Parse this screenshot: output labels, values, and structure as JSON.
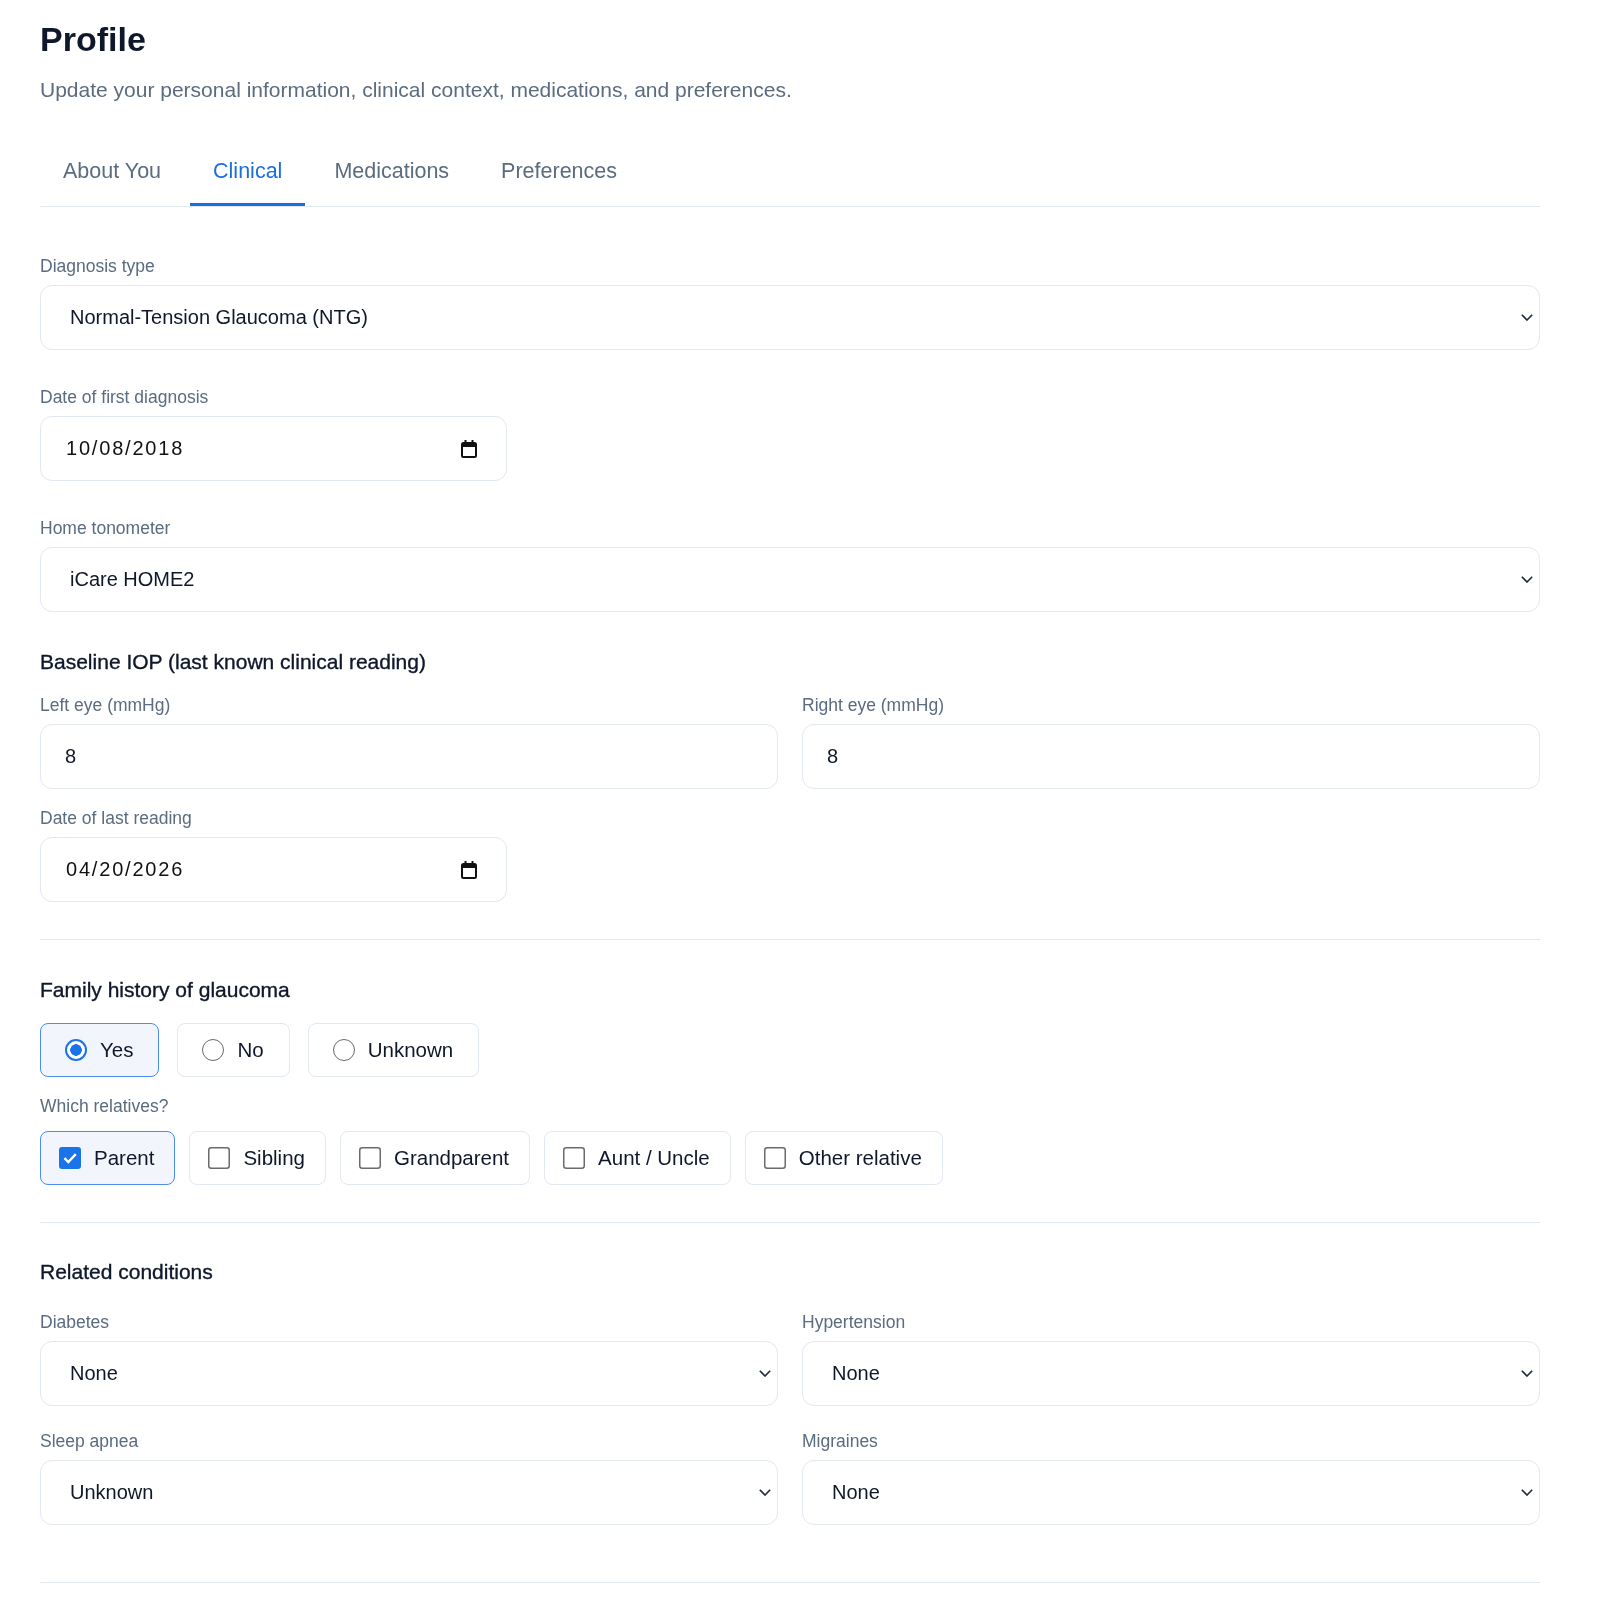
{
  "header": {
    "title": "Profile",
    "subtitle": "Update your personal information, clinical context, medications, and preferences."
  },
  "tabs": [
    {
      "label": "About You",
      "selected": false
    },
    {
      "label": "Clinical",
      "selected": true
    },
    {
      "label": "Medications",
      "selected": false
    },
    {
      "label": "Preferences",
      "selected": false
    }
  ],
  "diagnosis": {
    "fields": [
      {
        "kind": "select",
        "label": "Diagnosis type",
        "value": "Normal-Tension Glaucoma (NTG)"
      },
      {
        "kind": "date",
        "label": "Date of first diagnosis",
        "value": "10/08/2018"
      },
      {
        "kind": "select",
        "label": "Home tonometer",
        "value": "iCare HOME2"
      }
    ]
  },
  "baseline_iop": {
    "heading": "Baseline IOP (last known clinical reading)",
    "eyes": [
      {
        "kind": "number",
        "label": "Left eye (mmHg)",
        "value": "8"
      },
      {
        "kind": "number",
        "label": "Right eye (mmHg)",
        "value": "8"
      }
    ],
    "last_reading": {
      "kind": "date",
      "label": "Date of last reading",
      "value": "04/20/2026"
    }
  },
  "family_history": {
    "heading": "Family history of glaucoma",
    "options": [
      {
        "label": "Yes",
        "selected": true
      },
      {
        "label": "No",
        "selected": false
      },
      {
        "label": "Unknown",
        "selected": false
      }
    ],
    "relatives_label": "Which relatives?",
    "relatives": [
      {
        "label": "Parent",
        "checked": true
      },
      {
        "label": "Sibling",
        "checked": false
      },
      {
        "label": "Grandparent",
        "checked": false
      },
      {
        "label": "Aunt / Uncle",
        "checked": false
      },
      {
        "label": "Other relative",
        "checked": false
      }
    ]
  },
  "related_conditions": {
    "heading": "Related conditions",
    "fields": [
      {
        "kind": "select",
        "label": "Diabetes",
        "value": "None"
      },
      {
        "kind": "select",
        "label": "Hypertension",
        "value": "None"
      },
      {
        "kind": "select",
        "label": "Sleep apnea",
        "value": "Unknown"
      },
      {
        "kind": "select",
        "label": "Migraines",
        "value": "None"
      }
    ]
  }
}
